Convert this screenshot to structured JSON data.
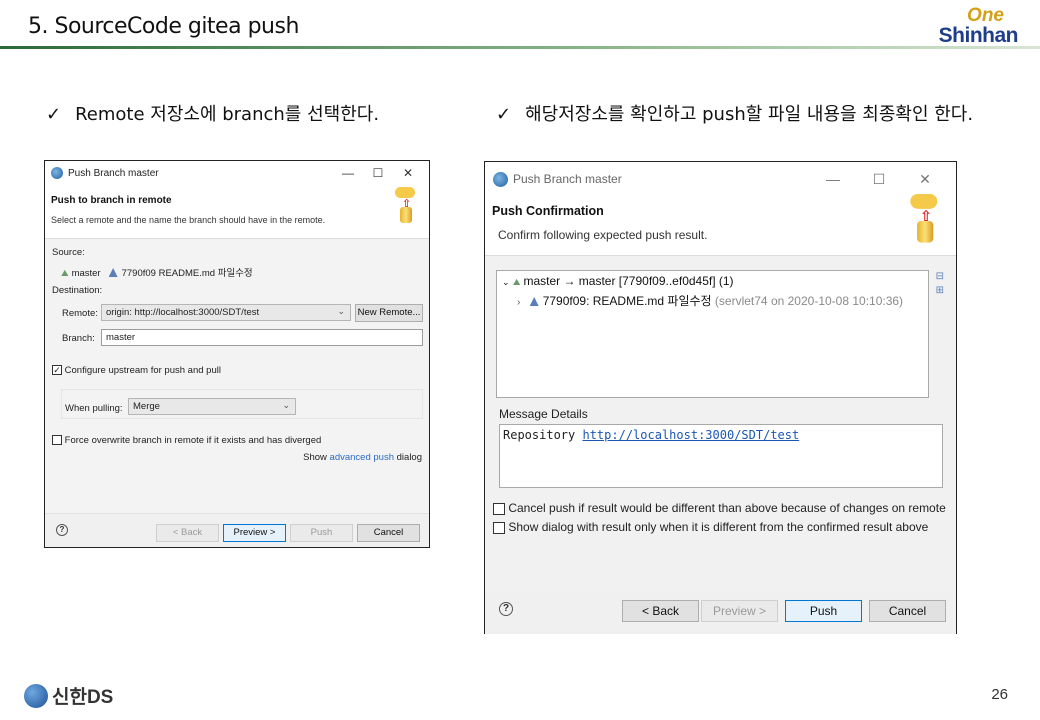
{
  "slide": {
    "title": "5. SourceCode gitea push",
    "brand_one": "One",
    "brand_shinhan": "Shinhan",
    "caption_left": "Remote 저장소에 branch를 선택한다.",
    "caption_right": "해당저장소를 확인하고 push할 파일 내용을 최종확인 한다.",
    "check_mark": "✓",
    "footer_logo": "신한DS",
    "page_number": "26"
  },
  "left_dialog": {
    "window_title": "Push Branch master",
    "header_title": "Push to branch in remote",
    "header_subtitle": "Select a remote and the name the branch should have in the remote.",
    "source_label": "Source:",
    "source_branch": "master",
    "source_commit": "7790f09  README.md 파일수정",
    "destination_label": "Destination:",
    "remote_label": "Remote:",
    "remote_value": "origin: http://localhost:3000/SDT/test",
    "new_remote_button": "New Remote...",
    "branch_label": "Branch:",
    "branch_value": "master",
    "configure_upstream": "Configure upstream for push and pull",
    "configure_upstream_checked": true,
    "when_pulling_label": "When pulling:",
    "when_pulling_value": "Merge",
    "force_overwrite": "Force overwrite branch in remote if it exists and has diverged",
    "force_overwrite_checked": false,
    "show_prefix": "Show",
    "advanced_push_link": "advanced push",
    "show_suffix": "dialog",
    "buttons": {
      "back": "< Back",
      "preview": "Preview >",
      "push": "Push",
      "cancel": "Cancel"
    },
    "help": "?"
  },
  "right_dialog": {
    "window_title": "Push Branch master",
    "header_title": "Push Confirmation",
    "header_subtitle": "Confirm following expected push result.",
    "tree": {
      "ref_row": "master → master [7790f09..ef0d45f] (1)",
      "commit_row": "7790f09: README.md 파일수정",
      "commit_meta": "(servlet74 on 2020-10-08 10:10:36)"
    },
    "message_details_label": "Message Details",
    "message_prefix": "Repository",
    "message_link": "http://localhost:3000/SDT/test",
    "cancel_push_option": "Cancel push if result would be different than above because of changes on remote",
    "cancel_push_checked": false,
    "show_dialog_option": "Show dialog with result only when it is different from the confirmed result above",
    "show_dialog_checked": false,
    "buttons": {
      "back": "< Back",
      "preview": "Preview >",
      "push": "Push",
      "cancel": "Cancel"
    },
    "help": "?"
  }
}
